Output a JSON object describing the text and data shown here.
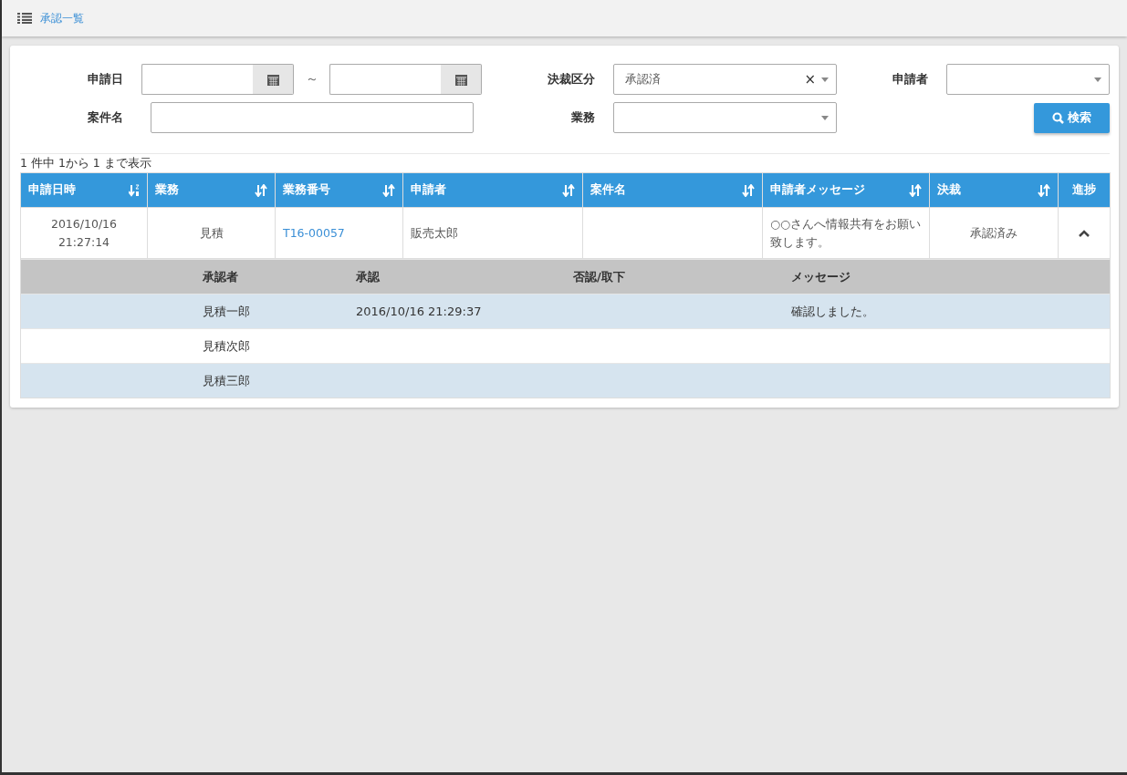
{
  "header": {
    "title": "承認一覧"
  },
  "filters": {
    "date_label": "申請日",
    "range_separator": "～",
    "subject_label": "案件名",
    "decision_label": "決裁区分",
    "decision_value": "承認済",
    "decision_clear": "×",
    "business_label": "業務",
    "applicant_label": "申請者",
    "search_button": "検索"
  },
  "summary": "1 件中 1から 1 まで表示",
  "table": {
    "columns": [
      {
        "label": "申請日時",
        "kind": "sorted"
      },
      {
        "label": "業務",
        "kind": "sortable"
      },
      {
        "label": "業務番号",
        "kind": "sortable"
      },
      {
        "label": "申請者",
        "kind": "sortable"
      },
      {
        "label": "案件名",
        "kind": "sortable"
      },
      {
        "label": "申請者メッセージ",
        "kind": "sortable"
      },
      {
        "label": "決裁",
        "kind": "sortable"
      },
      {
        "label": "進捗",
        "kind": "plain"
      }
    ],
    "rows": [
      {
        "expanded": true,
        "cells": [
          {
            "kind": "center",
            "text": "2016/10/16\n21:27:14"
          },
          {
            "kind": "center",
            "text": "見積"
          },
          {
            "kind": "link",
            "text": "T16-00057"
          },
          {
            "kind": "left",
            "text": "販売太郎"
          },
          {
            "kind": "left",
            "text": ""
          },
          {
            "kind": "left",
            "text": "○○さんへ情報共有をお願い致します。"
          },
          {
            "kind": "center",
            "text": "承認済み"
          }
        ],
        "approvals": {
          "columns": [
            "承認者",
            "承認",
            "否認/取下",
            "メッセージ"
          ],
          "rows": [
            [
              "見積一郎",
              "2016/10/16 21:29:37",
              "",
              "確認しました。"
            ],
            [
              "見積次郎",
              "",
              "",
              ""
            ],
            [
              "見積三郎",
              "",
              "",
              ""
            ]
          ]
        }
      }
    ]
  }
}
